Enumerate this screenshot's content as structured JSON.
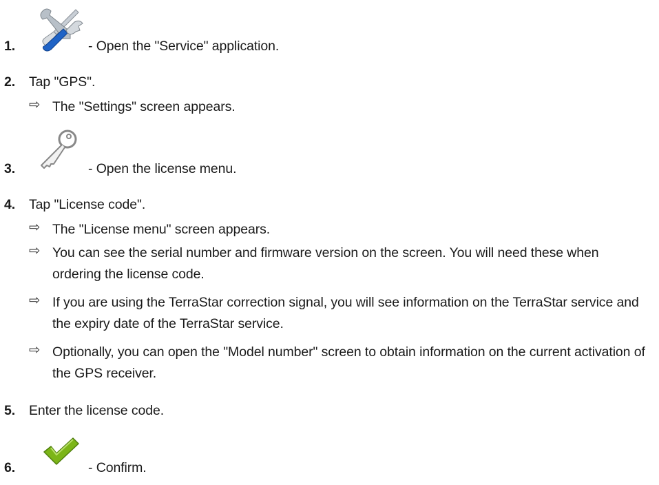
{
  "steps": [
    {
      "num": "1.",
      "icon": "service-tools-icon",
      "text": "- Open the \"Service\" application."
    },
    {
      "num": "2.",
      "text": "Tap \"GPS\".",
      "results": [
        "The \"Settings\" screen appears."
      ]
    },
    {
      "num": "3.",
      "icon": "key-icon",
      "text": "- Open the license menu."
    },
    {
      "num": "4.",
      "text": "Tap \"License code\".",
      "results": [
        "The \"License menu\" screen appears.",
        "You can see the serial number and firmware version on the screen. You will need these when ordering the license code.",
        "If you are using the TerraStar correction signal, you will see information on the TerraStar service and the expiry date of the TerraStar service.",
        "Optionally, you can open the \"Model number\" screen to obtain information on the current activation of the GPS receiver."
      ]
    },
    {
      "num": "5.",
      "text": "Enter the license code."
    },
    {
      "num": "6.",
      "icon": "checkmark-icon",
      "text": "- Confirm."
    }
  ],
  "result_arrow": "⇨",
  "colors": {
    "text": "#1a1a1a",
    "checkmark": "#7cb518",
    "wrench_blue": "#1f63c6"
  }
}
